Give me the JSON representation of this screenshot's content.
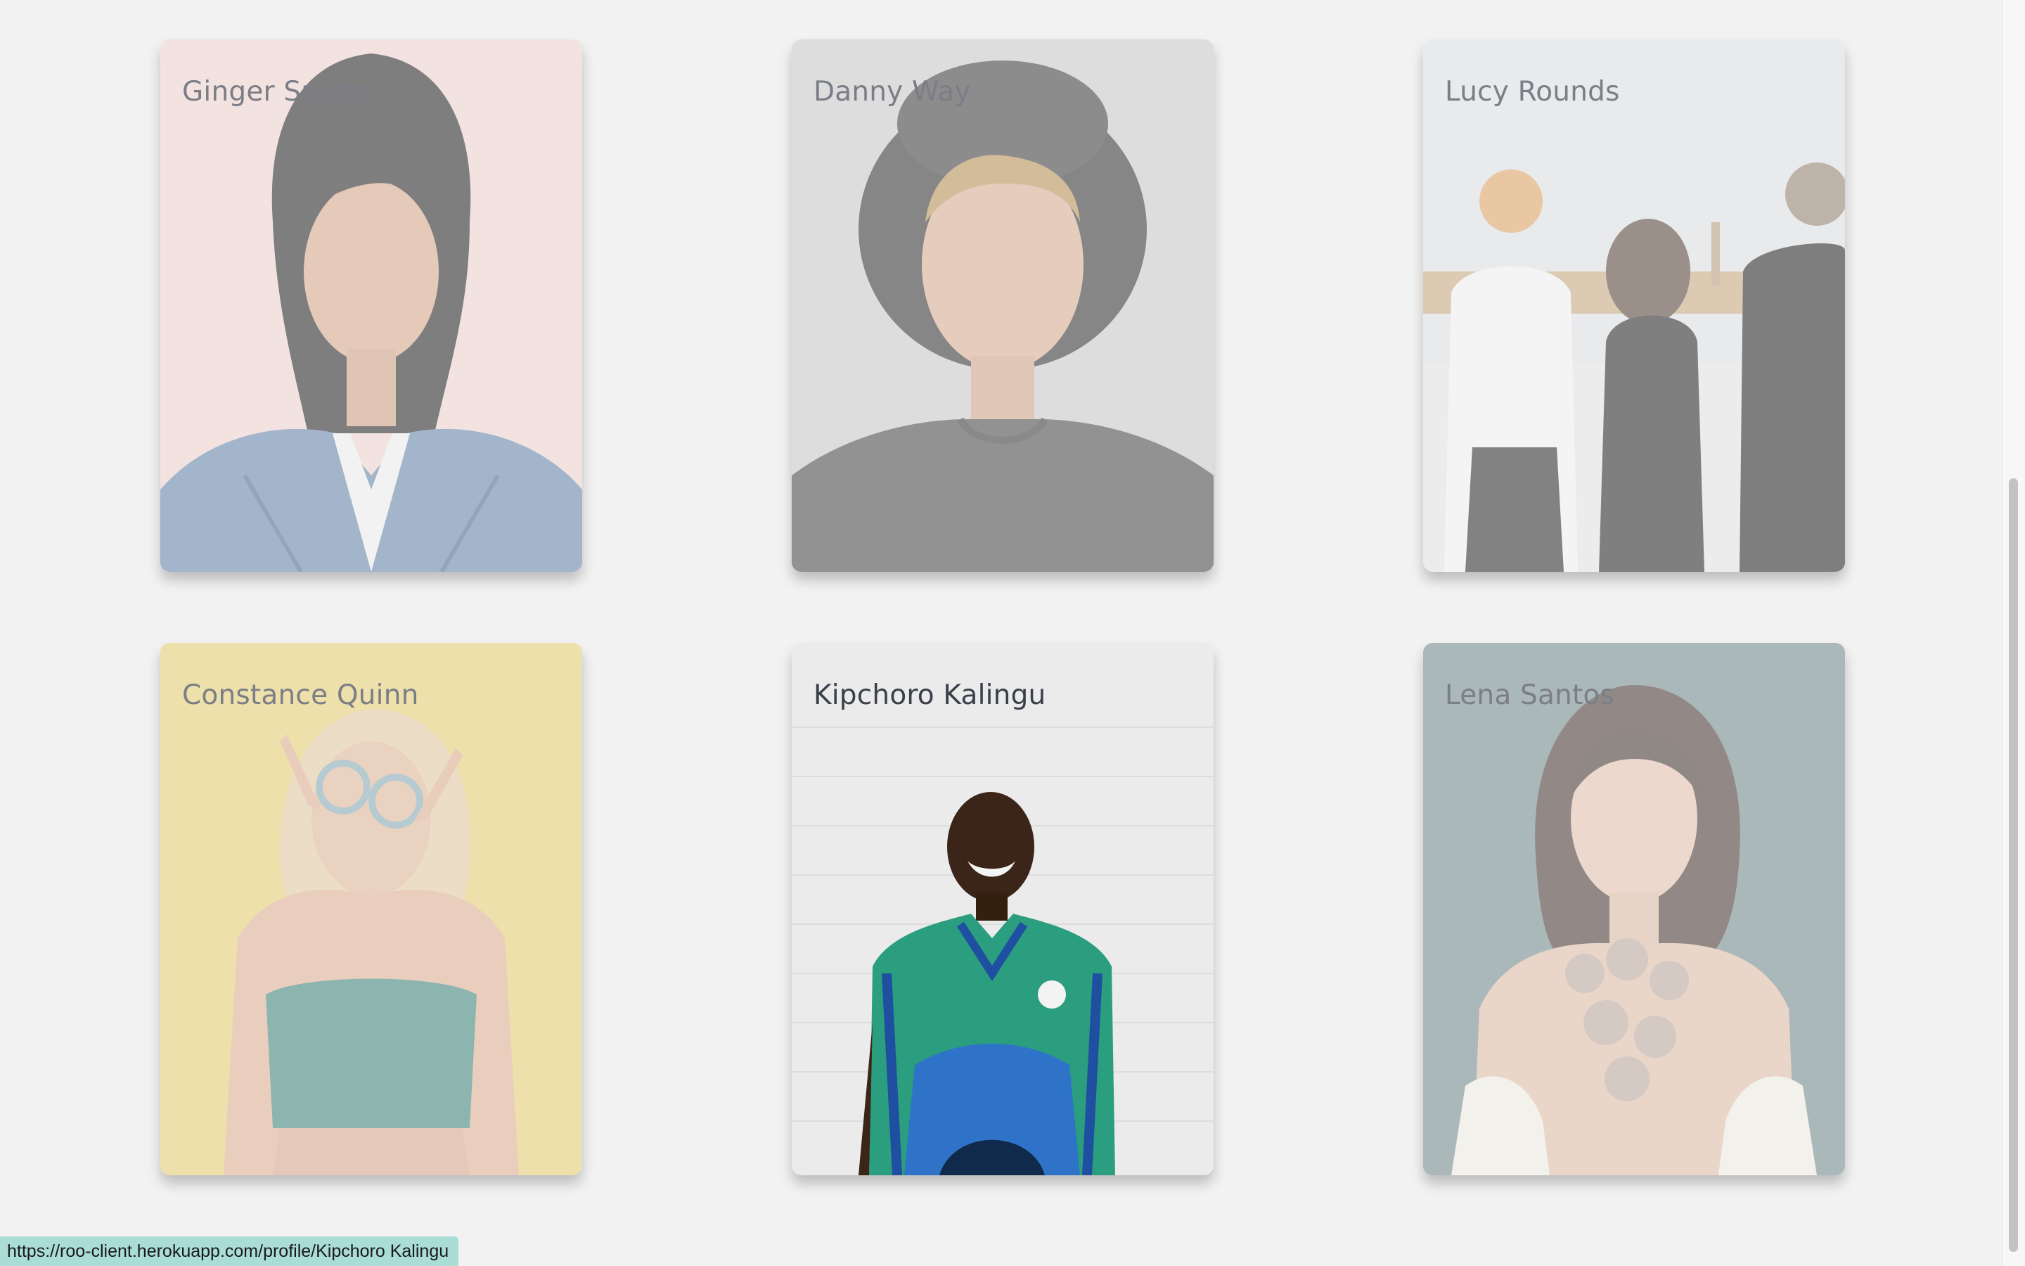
{
  "profiles": [
    {
      "name": "Ginger Snaps",
      "active": false
    },
    {
      "name": "Danny Way",
      "active": false
    },
    {
      "name": "Lucy Rounds",
      "active": false
    },
    {
      "name": "Constance Quinn",
      "active": false
    },
    {
      "name": "Kipchoro Kalingu",
      "active": true
    },
    {
      "name": "Lena Santos",
      "active": false
    }
  ],
  "status_bar": {
    "url": "https://roo-client.herokuapp.com/profile/Kipchoro Kalingu"
  },
  "colors": {
    "page_background": "#f2f2f2",
    "status_bar_background": "#a9ddd6"
  }
}
